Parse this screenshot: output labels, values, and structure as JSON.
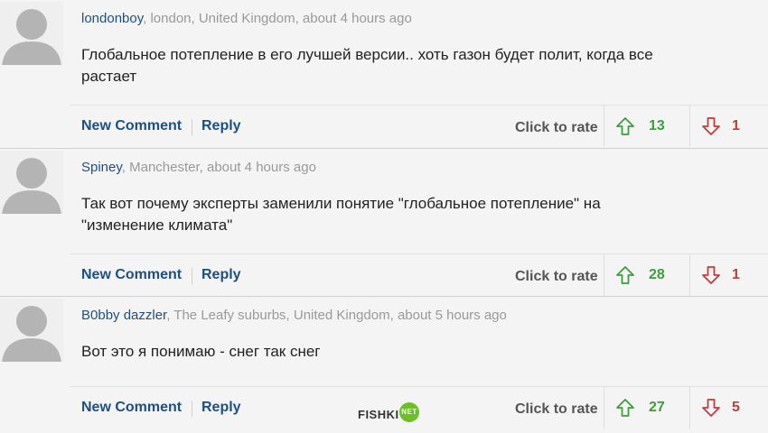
{
  "comments": [
    {
      "author": "londonboy",
      "location_time": ", london, United Kingdom, about 4 hours ago",
      "text": "Глобальное потепление в его лучшей версии.. хоть газон будет полит, когда все растает",
      "new_comment_label": "New Comment",
      "reply_label": "Reply",
      "rate_label": "Click to rate",
      "up_count": "13",
      "down_count": "1"
    },
    {
      "author": "Spiney",
      "location_time": ", Manchester, about 4 hours ago",
      "text": "Так вот почему эксперты заменили понятие \"глобальное потепление\" на \"изменение климата\"",
      "new_comment_label": "New Comment",
      "reply_label": "Reply",
      "rate_label": "Click to rate",
      "up_count": "28",
      "down_count": "1"
    },
    {
      "author": "B0bby dazzler",
      "location_time": ", The Leafy suburbs, United Kingdom, about 5 hours ago",
      "text": "Вот это я понимаю - снег так снег",
      "new_comment_label": "New Comment",
      "reply_label": "Reply",
      "rate_label": "Click to rate",
      "up_count": "27",
      "down_count": "5"
    }
  ],
  "watermark": {
    "word": "FISHKI",
    "badge": "NET"
  },
  "icons": {
    "avatar": "default-user-silhouette",
    "upvote": "arrow-up-outline-icon",
    "downvote": "arrow-down-outline-icon"
  },
  "colors": {
    "author": "#1e4f80",
    "up": "#3c9e3c",
    "down": "#c23c3c",
    "badge": "#6cbf2a"
  }
}
